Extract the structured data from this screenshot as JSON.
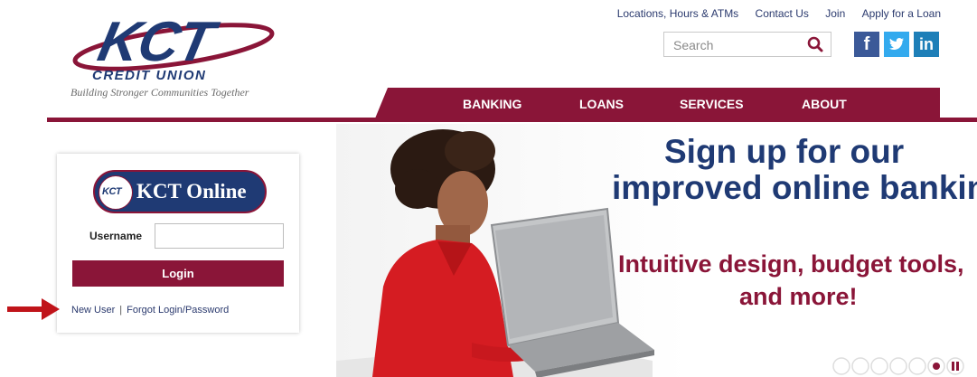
{
  "brand": {
    "logo_text": "KCT",
    "logo_subtext": "CREDIT UNION",
    "tagline": "Building Stronger Communities Together",
    "colors": {
      "navy": "#1f3a74",
      "maroon": "#8a1538"
    }
  },
  "topnav": {
    "links": [
      "Locations, Hours & ATMs",
      "Contact Us",
      "Join",
      "Apply for a Loan"
    ]
  },
  "search": {
    "placeholder": "Search",
    "icon": "search-icon"
  },
  "social": {
    "facebook": "f",
    "twitter": "twitter-bird",
    "linkedin": "in"
  },
  "mainnav": {
    "items": [
      "BANKING",
      "LOANS",
      "SERVICES",
      "ABOUT"
    ]
  },
  "login": {
    "brand_badge": "KCT",
    "title": "KCT Online",
    "username_label": "Username",
    "username_value": "",
    "button_label": "Login",
    "new_user_link": "New User",
    "separator": "|",
    "forgot_link": "Forgot Login/Password"
  },
  "hero": {
    "headline_1": "Sign up for our",
    "headline_2": "improved online banking",
    "subline_1": "Intuitive design, budget tools,",
    "subline_2": "and more!"
  },
  "carousel": {
    "slide_count": 6,
    "active_slide": 6,
    "state": "playing",
    "pause_icon": "pause-icon"
  }
}
